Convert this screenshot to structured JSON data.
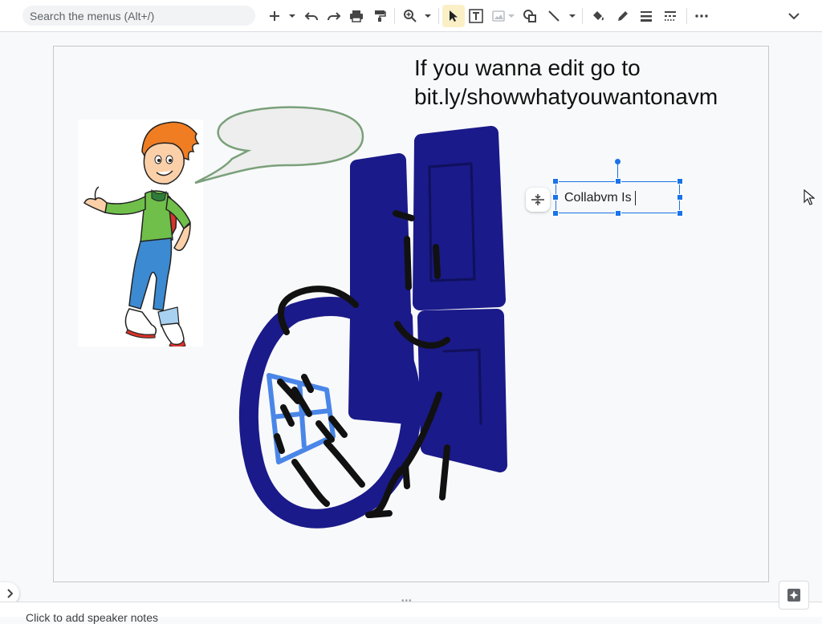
{
  "toolbar": {
    "search_placeholder": "Search the menus (Alt+/)",
    "active_tool": "select",
    "icons": [
      "plus-icon",
      "undo-icon",
      "redo-icon",
      "print-icon",
      "paint-format-icon",
      "zoom-icon",
      "cursor-icon",
      "textbox-icon",
      "image-icon",
      "shape-icon",
      "line-icon",
      "fill-color-icon",
      "pen-icon",
      "line-weight-icon",
      "line-dash-icon",
      "more-icon",
      "chevron-down-icon"
    ]
  },
  "slide": {
    "title": "If you wanna edit go to bit.ly/showwhatyouwantonavm",
    "textbox_value": "Collabvm Is"
  },
  "notes": {
    "text": "Click to add speaker notes"
  },
  "colors": {
    "selection": "#1a73e8",
    "navy_ink": "#1a1a8a",
    "black_ink": "#111111",
    "light_blue_ink": "#4a86e8",
    "active_tool_bg": "#fbefc6"
  }
}
